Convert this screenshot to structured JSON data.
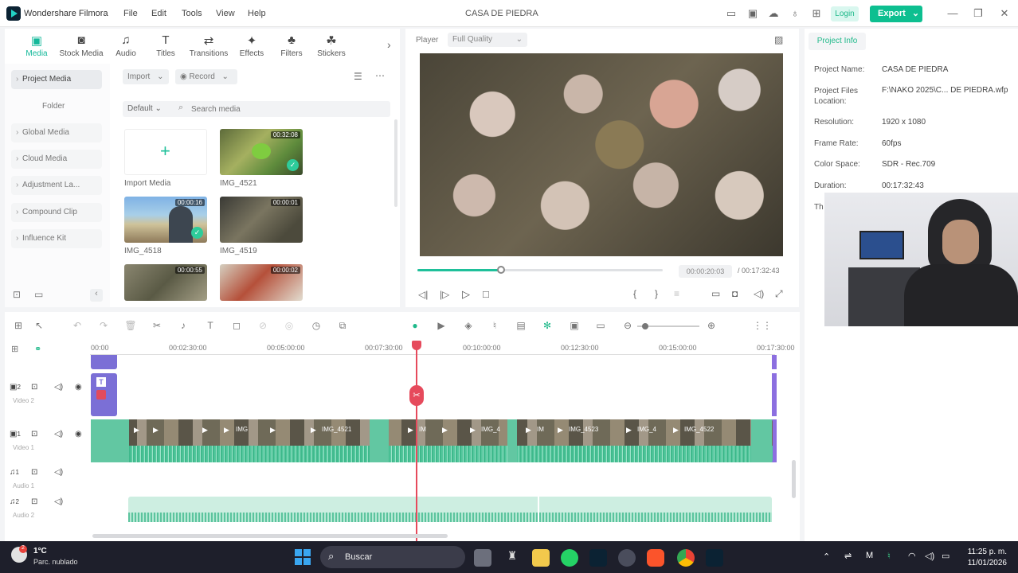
{
  "app": {
    "name": "Wondershare Filmora",
    "project_title": "CASA DE PIEDRA",
    "menu": [
      "File",
      "Edit",
      "Tools",
      "View",
      "Help"
    ],
    "login": "Login",
    "export": "Export"
  },
  "toolbar": {
    "tabs": [
      "Media",
      "Stock Media",
      "Audio",
      "Titles",
      "Transitions",
      "Effects",
      "Filters",
      "Stickers"
    ]
  },
  "sidebar": {
    "items": [
      "Project Media",
      "Folder",
      "Global Media",
      "Cloud Media",
      "Adjustment La...",
      "Compound Clip",
      "Influence Kit"
    ]
  },
  "media": {
    "import_btn": "Import",
    "record_btn": "Record",
    "sort": "Default",
    "search_placeholder": "Search media",
    "items": [
      {
        "name": "Import Media",
        "duration": ""
      },
      {
        "name": "IMG_4521",
        "duration": "00:32:08"
      },
      {
        "name": "IMG_4518",
        "duration": "00:00:16"
      },
      {
        "name": "IMG_4519",
        "duration": "00:00:01"
      },
      {
        "name": "",
        "duration": "00:00:55"
      },
      {
        "name": "",
        "duration": "00:00:02"
      }
    ]
  },
  "player": {
    "label": "Player",
    "quality": "Full Quality",
    "current_time": "00:00:20:03",
    "total_time": "/ 00:17:32:43",
    "progress": 0.34
  },
  "project_info": {
    "tab": "Project Info",
    "fields": [
      {
        "label": "Project Name:",
        "value": "CASA DE PIEDRA"
      },
      {
        "label": "Project Files Location:",
        "value": "F:\\NAKO 2025\\C... DE PIEDRA.wfp"
      },
      {
        "label": "Resolution:",
        "value": "1920 x 1080"
      },
      {
        "label": "Frame Rate:",
        "value": "60fps"
      },
      {
        "label": "Color Space:",
        "value": "SDR - Rec.709"
      },
      {
        "label": "Duration:",
        "value": "00:17:32:43"
      },
      {
        "label": "Th",
        "value": ""
      }
    ]
  },
  "timeline": {
    "ruler": [
      "00:00",
      "00:02:30:00",
      "00:05:00:00",
      "00:07:30:00",
      "00:10:00:00",
      "00:12:30:00",
      "00:15:00:00",
      "00:17:30:00"
    ],
    "tracks": [
      {
        "num": "2",
        "name": "Video 2"
      },
      {
        "num": "1",
        "name": "Video 1"
      },
      {
        "num": "1",
        "name": "Audio 1"
      },
      {
        "num": "2",
        "name": "Audio 2"
      }
    ],
    "clip_labels": [
      "IMG",
      "IMG_4521",
      "IM",
      "IMG_4",
      "IM",
      "IMG_4523",
      "IMG_4",
      "IMG_4522"
    ]
  },
  "taskbar": {
    "weather_temp": "1°C",
    "weather_desc": "Parc. nublado",
    "search": "Buscar",
    "time": "11:25 p. m.",
    "date": "11/01/2026"
  }
}
